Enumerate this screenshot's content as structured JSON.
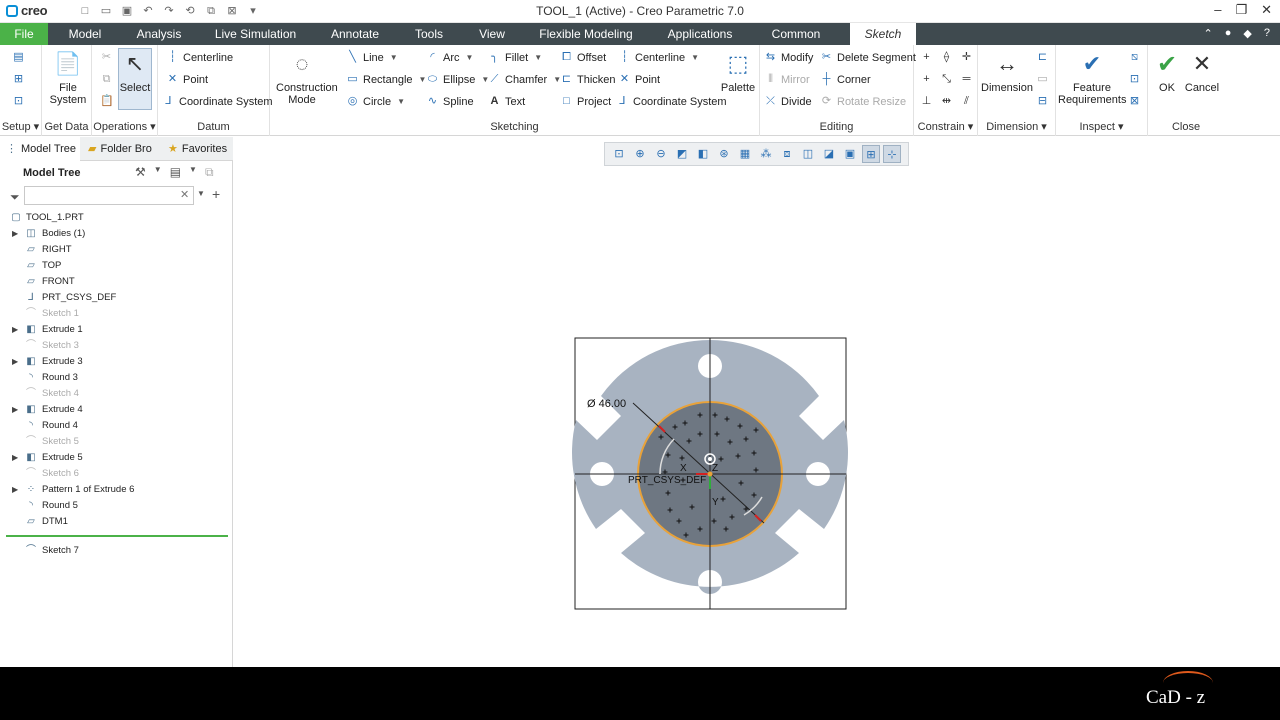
{
  "app": {
    "logo": "creo",
    "title": "TOOL_1 (Active) - Creo Parametric 7.0"
  },
  "tabs": [
    "File",
    "Model",
    "Analysis",
    "Live Simulation",
    "Annotate",
    "Tools",
    "View",
    "Flexible Modeling",
    "Applications",
    "Common",
    "Sketch"
  ],
  "ribbon": {
    "groups": {
      "setup": "Setup",
      "get_data": "Get Data",
      "operations": "Operations",
      "datum": "Datum",
      "sketching": "Sketching",
      "editing": "Editing",
      "constrain": "Constrain",
      "dimension": "Dimension",
      "inspect": "Inspect",
      "close": "Close"
    },
    "file_system": "File System",
    "select": "Select",
    "datum_items": [
      "Centerline",
      "Point",
      "Coordinate System"
    ],
    "construction_mode": "Construction Mode",
    "sketch_col1": [
      "Line",
      "Rectangle",
      "Circle"
    ],
    "sketch_col2": [
      "Arc",
      "Ellipse",
      "Spline"
    ],
    "sketch_col3": [
      "Fillet",
      "Chamfer",
      "Text"
    ],
    "sketch_col4": [
      "Offset",
      "Thicken",
      "Project"
    ],
    "sketch_col5": [
      "Centerline",
      "Point",
      "Coordinate System"
    ],
    "palette": "Palette",
    "edit_col1": [
      "Modify",
      "Mirror",
      "Divide"
    ],
    "edit_col2": [
      "Delete Segment",
      "Corner",
      "Rotate Resize"
    ],
    "dimension_btn": "Dimension",
    "feature_requirements": "Feature Requirements",
    "ok": "OK",
    "cancel": "Cancel"
  },
  "panel": {
    "tabs": [
      "Model Tree",
      "Folder Bro",
      "Favorites"
    ],
    "title": "Model Tree",
    "search_value": "",
    "tree": [
      {
        "label": "TOOL_1.PRT",
        "expandable": false,
        "dim": false,
        "icon": "part"
      },
      {
        "label": "Bodies (1)",
        "expandable": true,
        "dim": false,
        "icon": "bodies"
      },
      {
        "label": "RIGHT",
        "expandable": false,
        "dim": false,
        "icon": "plane"
      },
      {
        "label": "TOP",
        "expandable": false,
        "dim": false,
        "icon": "plane"
      },
      {
        "label": "FRONT",
        "expandable": false,
        "dim": false,
        "icon": "plane"
      },
      {
        "label": "PRT_CSYS_DEF",
        "expandable": false,
        "dim": false,
        "icon": "csys"
      },
      {
        "label": "Sketch 1",
        "expandable": false,
        "dim": true,
        "icon": "sketch"
      },
      {
        "label": "Extrude 1",
        "expandable": true,
        "dim": false,
        "icon": "extrude"
      },
      {
        "label": "Sketch 3",
        "expandable": false,
        "dim": true,
        "icon": "sketch"
      },
      {
        "label": "Extrude 3",
        "expandable": true,
        "dim": false,
        "icon": "extrude"
      },
      {
        "label": "Round 3",
        "expandable": false,
        "dim": false,
        "icon": "round"
      },
      {
        "label": "Sketch 4",
        "expandable": false,
        "dim": true,
        "icon": "sketch"
      },
      {
        "label": "Extrude 4",
        "expandable": true,
        "dim": false,
        "icon": "extrude"
      },
      {
        "label": "Round 4",
        "expandable": false,
        "dim": false,
        "icon": "round"
      },
      {
        "label": "Sketch 5",
        "expandable": false,
        "dim": true,
        "icon": "sketch"
      },
      {
        "label": "Extrude 5",
        "expandable": true,
        "dim": false,
        "icon": "extrude"
      },
      {
        "label": "Sketch 6",
        "expandable": false,
        "dim": true,
        "icon": "sketch"
      },
      {
        "label": "Pattern 1 of Extrude 6",
        "expandable": true,
        "dim": false,
        "icon": "pattern"
      },
      {
        "label": "Round 5",
        "expandable": false,
        "dim": false,
        "icon": "round"
      },
      {
        "label": "DTM1",
        "expandable": false,
        "dim": false,
        "icon": "plane"
      }
    ],
    "active_item": "Sketch 7"
  },
  "canvas": {
    "dimension_label": "Ø 46.00",
    "csys_label": "PRT_CSYS_DEF",
    "axis_x": "X",
    "axis_y": "Y",
    "axis_z": "Z",
    "part_color": "#a8b3c1",
    "sketch_circle_color": "#e8a23a",
    "inner_fill_color": "#6e7782"
  },
  "watermark": "CaD - z"
}
